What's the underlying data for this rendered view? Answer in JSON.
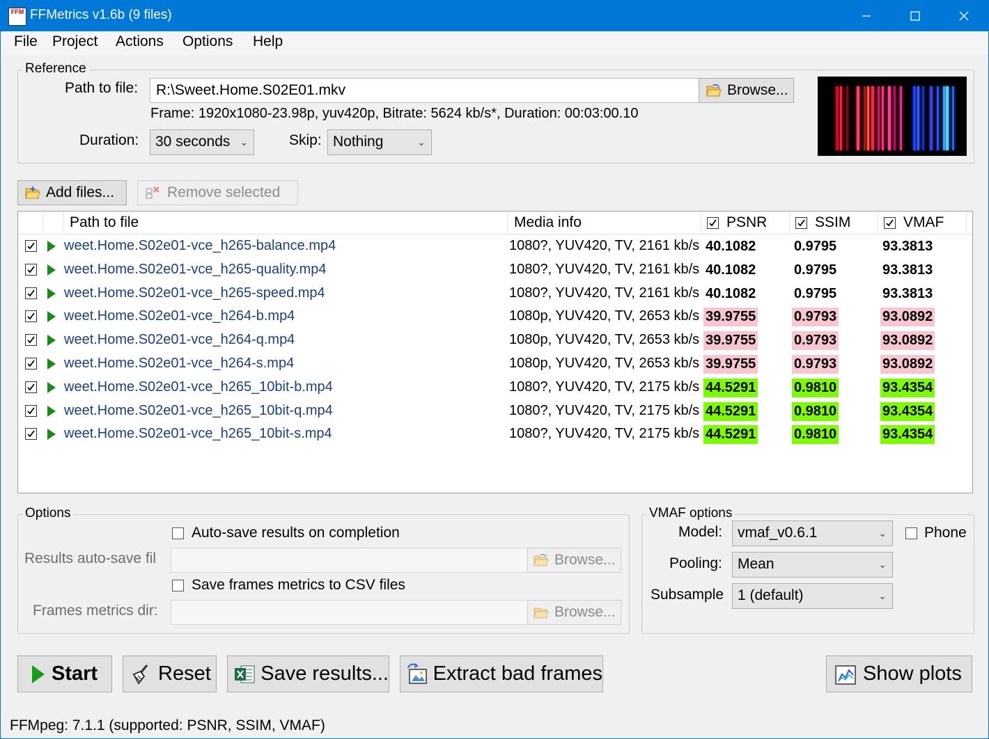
{
  "window": {
    "title": "FFMetrics v1.6b (9 files)",
    "app_icon_text": "FFM"
  },
  "menu": [
    "File",
    "Project",
    "Actions",
    "Options",
    "Help"
  ],
  "reference": {
    "group_label": "Reference",
    "path_label": "Path to file:",
    "path_value": "R:\\Sweet.Home.S02E01.mkv",
    "browse_label": "Browse...",
    "frame_info": "Frame: 1920x1080-23.98p, yuv420p, Bitrate: 5624 kb/s*, Duration: 00:03:00.10",
    "duration_label": "Duration:",
    "duration_value": "30 seconds",
    "skip_label": "Skip:",
    "skip_value": "Nothing"
  },
  "file_toolbar": {
    "add_label": "Add files...",
    "remove_label": "Remove selected"
  },
  "grid": {
    "headers": {
      "path": "Path to file",
      "media": "Media info",
      "psnr": "PSNR",
      "ssim": "SSIM",
      "vmaf": "VMAF"
    },
    "rows": [
      {
        "path": "weet.Home.S02e01-vce_h265-balance.mp4",
        "media": "1080?, YUV420, TV, 2161 kb/s",
        "psnr": "40.1082",
        "ssim": "0.9795",
        "vmaf": "93.3813",
        "status": "ref"
      },
      {
        "path": "weet.Home.S02e01-vce_h265-quality.mp4",
        "media": "1080?, YUV420, TV, 2161 kb/s",
        "psnr": "40.1082",
        "ssim": "0.9795",
        "vmaf": "93.3813",
        "status": "ref"
      },
      {
        "path": "weet.Home.S02e01-vce_h265-speed.mp4",
        "media": "1080?, YUV420, TV, 2161 kb/s",
        "psnr": "40.1082",
        "ssim": "0.9795",
        "vmaf": "93.3813",
        "status": "ref"
      },
      {
        "path": "weet.Home.S02e01-vce_h264-b.mp4",
        "media": "1080p, YUV420, TV, 2653 kb/s",
        "psnr": "39.9755",
        "ssim": "0.9793",
        "vmaf": "93.0892",
        "status": "worst"
      },
      {
        "path": "weet.Home.S02e01-vce_h264-q.mp4",
        "media": "1080p, YUV420, TV, 2653 kb/s",
        "psnr": "39.9755",
        "ssim": "0.9793",
        "vmaf": "93.0892",
        "status": "worst"
      },
      {
        "path": "weet.Home.S02e01-vce_h264-s.mp4",
        "media": "1080p, YUV420, TV, 2653 kb/s",
        "psnr": "39.9755",
        "ssim": "0.9793",
        "vmaf": "93.0892",
        "status": "worst"
      },
      {
        "path": "weet.Home.S02e01-vce_h265_10bit-b.mp4",
        "media": "1080?, YUV420, TV, 2175 kb/s",
        "psnr": "44.5291",
        "ssim": "0.9810",
        "vmaf": "93.4354",
        "status": "best"
      },
      {
        "path": "weet.Home.S02e01-vce_h265_10bit-q.mp4",
        "media": "1080?, YUV420, TV, 2175 kb/s",
        "psnr": "44.5291",
        "ssim": "0.9810",
        "vmaf": "93.4354",
        "status": "best"
      },
      {
        "path": "weet.Home.S02e01-vce_h265_10bit-s.mp4",
        "media": "1080?, YUV420, TV, 2175 kb/s",
        "psnr": "44.5291",
        "ssim": "0.9810",
        "vmaf": "93.4354",
        "status": "best"
      }
    ]
  },
  "options": {
    "group_label": "Options",
    "autosave_label": "Auto-save results on completion",
    "autosave_file_label": "Results auto-save fil",
    "autosave_file_value": "",
    "browse_label": "Browse...",
    "csv_label": "Save frames metrics to CSV files",
    "frames_dir_label": "Frames metrics dir:",
    "frames_dir_value": ""
  },
  "vmaf_options": {
    "group_label": "VMAF options",
    "model_label": "Model:",
    "model_value": "vmaf_v0.6.1",
    "phone_label": "Phone",
    "pooling_label": "Pooling:",
    "pooling_value": "Mean",
    "subsample_label": "Subsample",
    "subsample_value": "1 (default)"
  },
  "actions": {
    "start": "Start",
    "reset": "Reset",
    "save_results": "Save results...",
    "extract": "Extract bad frames",
    "show_plots": "Show plots"
  },
  "status_bar": "FFMpeg: 7.1.1 (supported: PSNR, SSIM, VMAF)",
  "colors": {
    "titlebar": "#0078d7",
    "worst": "#f7c6cf",
    "best": "#7cfc00",
    "path_text": "#1a3f86",
    "play": "#1a8a1a"
  },
  "thumbnail_stripes": [
    {
      "pos": 0.12,
      "color": "#c0102a"
    },
    {
      "pos": 0.15,
      "color": "#ff2040"
    },
    {
      "pos": 0.19,
      "color": "#8a0018"
    },
    {
      "pos": 0.26,
      "color": "#ff4060"
    },
    {
      "pos": 0.31,
      "color": "#a01028"
    },
    {
      "pos": 0.33,
      "color": "#ff6030"
    },
    {
      "pos": 0.36,
      "color": "#ff2050"
    },
    {
      "pos": 0.4,
      "color": "#d01860"
    },
    {
      "pos": 0.43,
      "color": "#ff3070"
    },
    {
      "pos": 0.47,
      "color": "#ff4090"
    },
    {
      "pos": 0.51,
      "color": "#b81060"
    },
    {
      "pos": 0.55,
      "color": "#e03080"
    },
    {
      "pos": 0.64,
      "color": "#2040ff"
    },
    {
      "pos": 0.67,
      "color": "#3060ff"
    },
    {
      "pos": 0.7,
      "color": "#1a30c0"
    },
    {
      "pos": 0.75,
      "color": "#4040e0"
    },
    {
      "pos": 0.8,
      "color": "#2a50ff"
    },
    {
      "pos": 0.84,
      "color": "#30a0ff"
    },
    {
      "pos": 0.86,
      "color": "#60d0ff"
    },
    {
      "pos": 0.9,
      "color": "#2060ff"
    }
  ]
}
